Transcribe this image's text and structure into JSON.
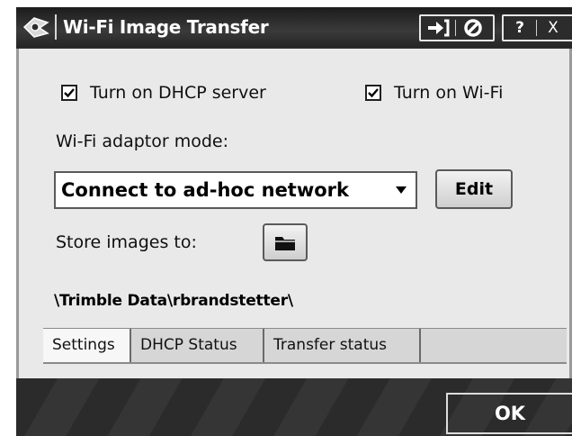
{
  "window": {
    "title": "Wi-Fi Image Transfer",
    "controls": {
      "help": "?",
      "close": "X"
    }
  },
  "settings": {
    "dhcp_label": "Turn on DHCP server",
    "dhcp_checked": true,
    "wifi_label": "Turn on Wi-Fi",
    "wifi_checked": true,
    "adaptor_mode_label": "Wi-Fi adaptor mode:",
    "adaptor_mode_value": "Connect to ad-hoc network",
    "edit_label": "Edit",
    "store_label": "Store images to:",
    "store_path": "\\Trimble Data\\rbrandstetter\\"
  },
  "tabs": [
    {
      "label": "Settings",
      "active": true
    },
    {
      "label": "DHCP Status",
      "active": false
    },
    {
      "label": "Transfer status",
      "active": false
    }
  ],
  "footer": {
    "ok_label": "OK"
  }
}
